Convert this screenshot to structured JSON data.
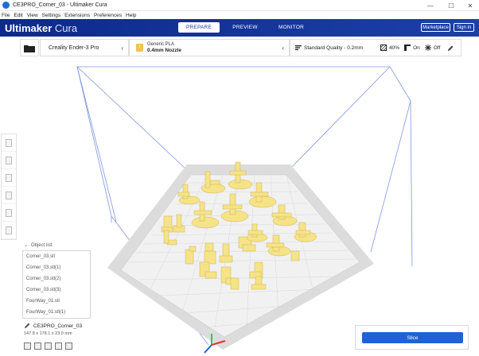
{
  "window": {
    "title": "CE3PRO_Corner_03 - Ultimaker Cura",
    "controls": {
      "minimize": "—",
      "maximize": "☐",
      "close": "✕"
    }
  },
  "menu": [
    "File",
    "Edit",
    "View",
    "Settings",
    "Extensions",
    "Preferences",
    "Help"
  ],
  "header": {
    "logo_bold": "Ultimaker",
    "logo_light": "Cura",
    "tabs": [
      {
        "label": "PREPARE",
        "active": true
      },
      {
        "label": "PREVIEW",
        "active": false
      },
      {
        "label": "MONITOR",
        "active": false
      }
    ],
    "marketplace_label": "Marketplace",
    "signin_label": "Sign in"
  },
  "toolbar": {
    "printer": "Creality Ender-3 Pro",
    "material_name": "Generic PLA",
    "nozzle": "0.4mm Nozzle",
    "quality": "Standard Quality - 0.2mm",
    "infill": "40%",
    "support": "On",
    "adhesion": "Off"
  },
  "object_list": {
    "header": "Object list",
    "items": [
      "Corner_03.stl",
      "Corner_03.stl(1)",
      "Corner_03.stl(2)",
      "Corner_03.stl(3)",
      "FourWay_01.stl",
      "FourWay_01.stl(1)"
    ]
  },
  "job": {
    "name": "CE3PRO_Corner_03",
    "dimensions": "147.8 x 178.1 x 23.0 mm"
  },
  "slice_label": "Slice",
  "colors": {
    "header": "#1c3fa8",
    "accent": "#1e62d6",
    "model": "#f7e48a",
    "model_shadow": "#d8c25a",
    "volume": "#6a8ae0"
  }
}
